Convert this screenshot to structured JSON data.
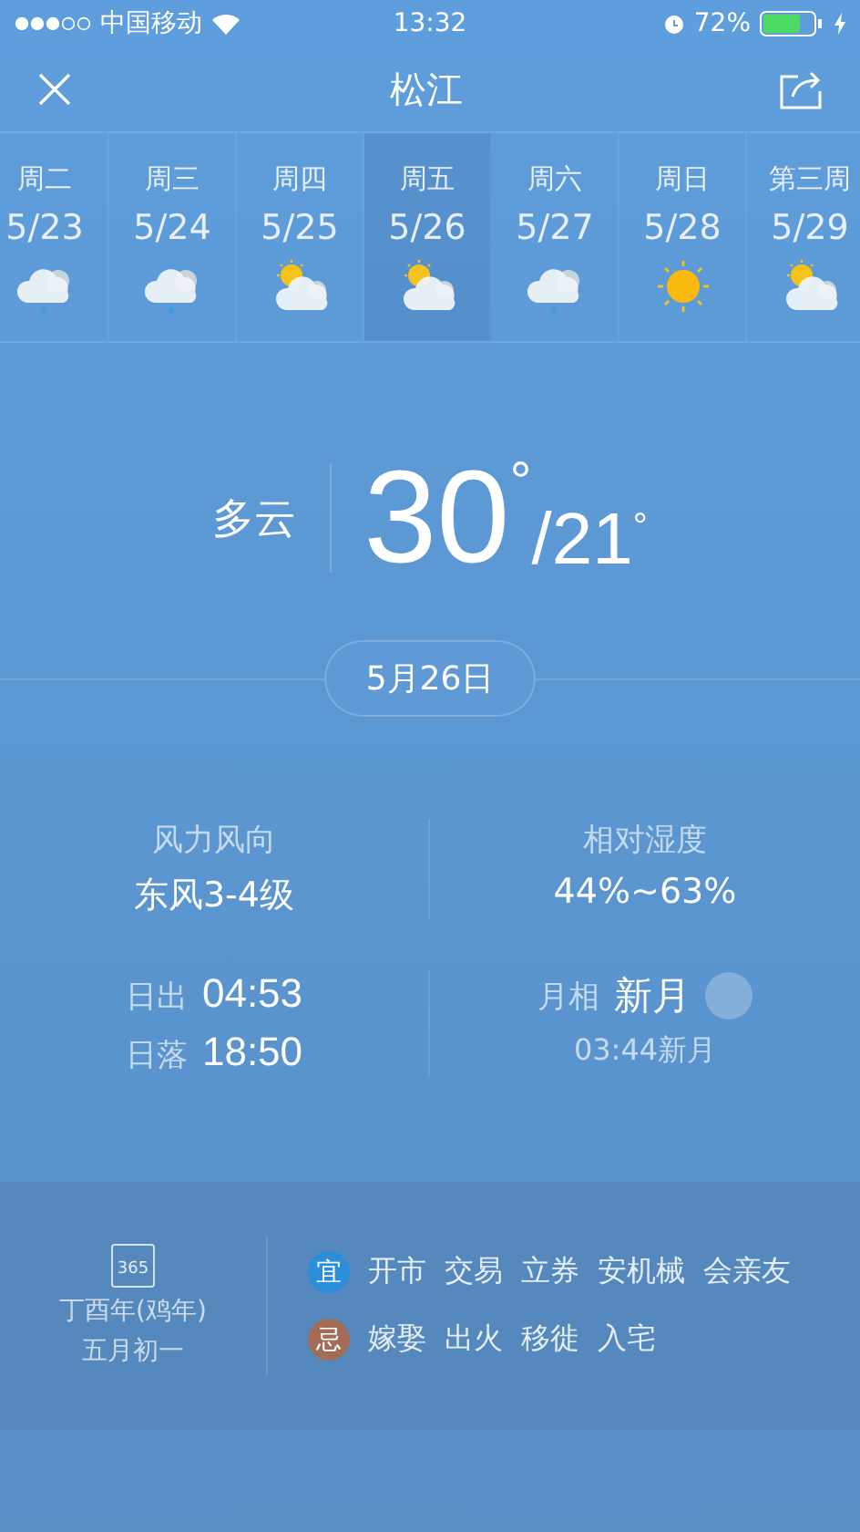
{
  "status_bar": {
    "carrier": "中国移动",
    "time": "13:32",
    "battery": "72%"
  },
  "header": {
    "title": "松江"
  },
  "days": [
    {
      "weekday": "周二",
      "date": "5/23",
      "kind": "rain",
      "selected": false
    },
    {
      "weekday": "周三",
      "date": "5/24",
      "kind": "rain",
      "selected": false
    },
    {
      "weekday": "周四",
      "date": "5/25",
      "kind": "partly",
      "selected": false
    },
    {
      "weekday": "周五",
      "date": "5/26",
      "kind": "partly",
      "selected": true
    },
    {
      "weekday": "周六",
      "date": "5/27",
      "kind": "rain",
      "selected": false
    },
    {
      "weekday": "周日",
      "date": "5/28",
      "kind": "sunny",
      "selected": false
    },
    {
      "weekday": "第三周",
      "date": "5/29",
      "kind": "partly",
      "selected": false
    }
  ],
  "current": {
    "condition": "多云",
    "high": "30",
    "high_unit": "°",
    "low": "/21",
    "low_unit": "°",
    "date": "5月26日"
  },
  "details": [
    {
      "label": "风力风向",
      "value": "东风3-4级"
    },
    {
      "label": "相对湿度",
      "value": "44%~63%"
    }
  ],
  "sun": [
    {
      "label": "日出",
      "value": "04:53"
    },
    {
      "label": "日落",
      "value": "18:50"
    }
  ],
  "moon": {
    "label": "月相",
    "value": "新月",
    "note": "03:44新月"
  },
  "almanac": {
    "calendar_icon_text": "365",
    "year": "丁酉年(鸡年)",
    "lunar_date": "五月初一",
    "rows": [
      {
        "tag": "宜",
        "color": "#2a8fd8",
        "items": [
          "开市",
          "交易",
          "立券",
          "安机械",
          "会亲友"
        ]
      },
      {
        "tag": "忌",
        "color": "#a26c57",
        "items": [
          "嫁娶",
          "出火",
          "移徙",
          "入宅"
        ]
      }
    ]
  }
}
